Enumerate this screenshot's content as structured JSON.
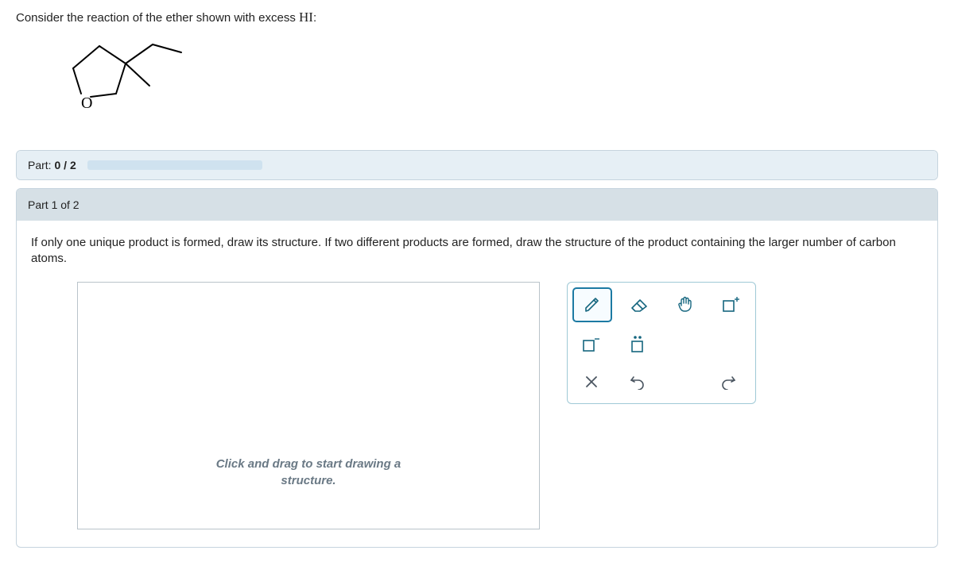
{
  "prompt": {
    "text_before": "Consider the reaction of the ether shown with excess ",
    "hi": "HI",
    "text_after": ":"
  },
  "molecule": {
    "oxygen_label": "O"
  },
  "progress": {
    "label_prefix": "Part: ",
    "current": "0",
    "sep": " / ",
    "total": "2"
  },
  "part": {
    "header": "Part 1 of 2",
    "instruction": "If only one unique product is formed, draw its structure. If two different products are formed, draw the structure of the product containing the larger number of carbon atoms.",
    "canvas_hint_line1": "Click and drag to start drawing a",
    "canvas_hint_line2": "structure."
  },
  "tools": {
    "pencil": "pencil",
    "eraser": "eraser",
    "hand": "hand",
    "chargeplus": "charge-plus",
    "chargeminus": "charge-minus",
    "lonepair": "lone-pair",
    "clear": "clear",
    "undo": "undo",
    "redo": "redo"
  }
}
